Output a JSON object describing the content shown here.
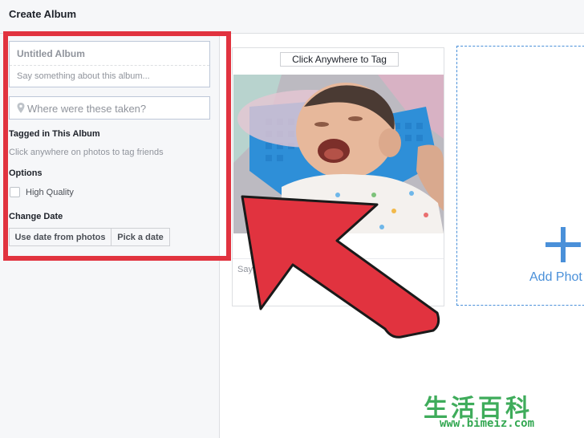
{
  "header": {
    "title": "Create Album"
  },
  "album": {
    "title_placeholder": "Untitled Album",
    "description_placeholder": "Say something about this album...",
    "location_placeholder": "Where were these taken?"
  },
  "tagged": {
    "heading": "Tagged in This Album",
    "hint": "Click anywhere on photos to tag friends"
  },
  "options": {
    "heading": "Options",
    "high_quality_label": "High Quality",
    "high_quality_checked": false
  },
  "change_date": {
    "heading": "Change Date",
    "use_date_button": "Use date from photos",
    "pick_date_button": "Pick a date"
  },
  "photo_card": {
    "tag_button": "Click Anywhere to Tag",
    "caption_placeholder": "Say someth"
  },
  "add_photos": {
    "label": "Add Phot"
  },
  "watermark": {
    "text": "生活百科",
    "url": "www.bimeiz.com"
  },
  "colors": {
    "highlight": "#e1333f",
    "arrow": "#e1333f",
    "accent": "#4a90d9",
    "watermark": "#35a853"
  }
}
